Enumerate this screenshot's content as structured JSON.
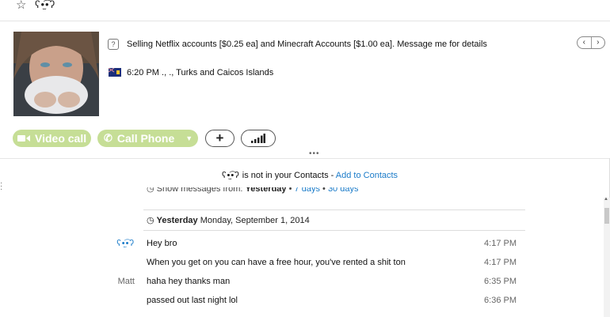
{
  "topbar": {
    "star_icon": "star-outline-icon",
    "contact_name": "ʕ•̫͡•ʔ"
  },
  "profile": {
    "mood_message": "Selling Netflix accounts [$0.25 ea] and Minecraft Accounts [$1.00 ea]. Message me for details",
    "location": "6:20 PM ., ., Turks and Caicos Islands"
  },
  "actions": {
    "video_call_label": "Video call",
    "call_phone_label": "Call Phone",
    "add_label": "+",
    "accent_color": "#c6de96"
  },
  "contact_notice": {
    "name": "ʕ•̫͡•ʔ",
    "text": "is not in your Contacts -",
    "link": "Add to Contacts"
  },
  "history": {
    "prefix": "Show messages from:",
    "current": "Yesterday",
    "option_7": "7 days",
    "option_30": "30 days"
  },
  "date_header": {
    "day": "Yesterday",
    "date": "Monday, September 1, 2014"
  },
  "messages": [
    {
      "sender": "ʕ•̫͡•ʔ",
      "text": "Hey bro",
      "time": "4:17 PM"
    },
    {
      "sender": "",
      "text": "When you get on you can have a free hour, you've rented a shit ton",
      "time": "4:17 PM"
    },
    {
      "sender": "Matt",
      "text": "haha hey thanks man",
      "time": "6:35 PM"
    },
    {
      "sender": "",
      "text": "passed out last night lol",
      "time": "6:36 PM"
    }
  ]
}
